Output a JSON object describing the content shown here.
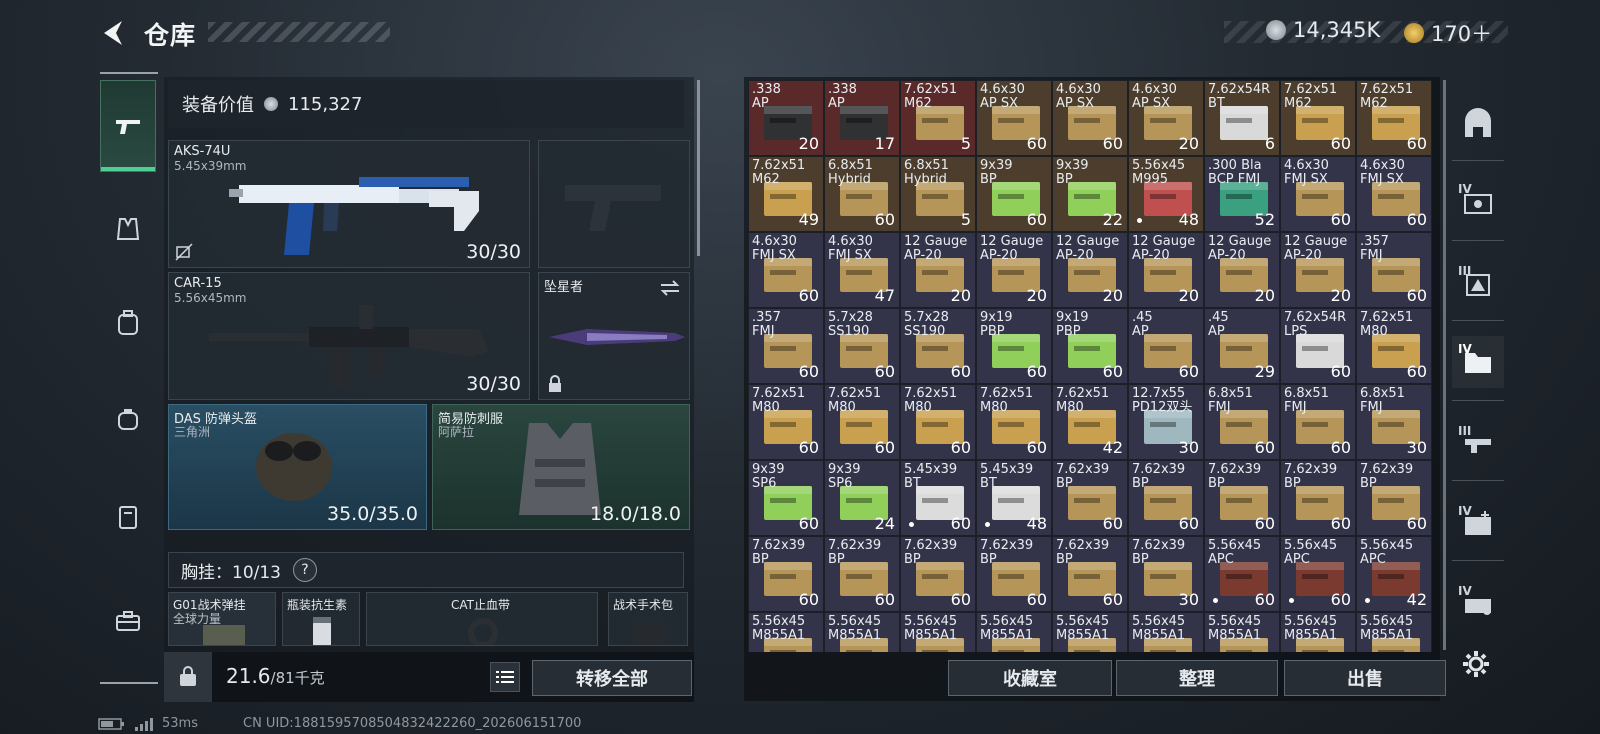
{
  "header": {
    "title": "仓库"
  },
  "currency": {
    "primary": "14,345K",
    "secondary": "170＋"
  },
  "equip_value": {
    "label": "装备价值",
    "value": "115,327"
  },
  "weapons": [
    {
      "name": "AKS-74U",
      "caliber": "5.45x39mm",
      "ammo": "30/30"
    },
    {
      "name": "CAR-15",
      "caliber": "5.56x45mm",
      "ammo": "30/30"
    }
  ],
  "melee": {
    "name": "坠星者"
  },
  "helmet": {
    "name": "DAS 防弹头盔",
    "origin": "三角洲",
    "durability": "35.0/35.0"
  },
  "armor": {
    "name": "简易防刺服",
    "origin": "阿萨拉",
    "durability": "18.0/18.0"
  },
  "rig": {
    "label": "胸挂：",
    "capacity": "10/13",
    "help": "?"
  },
  "rig_slots": [
    {
      "name": "G01战术弹挂",
      "sub": "全球力量"
    },
    {
      "name": "瓶装抗生素",
      "sub": ""
    },
    {
      "name": "CAT止血带",
      "sub": ""
    },
    {
      "name": "战术手术包",
      "sub": ""
    }
  ],
  "weight": {
    "current": "21.6",
    "max": "/81千克"
  },
  "buttons": {
    "transfer_all": "转移全部",
    "collection": "收藏室",
    "organize": "整理",
    "sell": "出售"
  },
  "status": {
    "ping": "53ms",
    "uid": "CN UID:1881595708504832422260_202606151700"
  },
  "right_nav": [
    "",
    "IV",
    "III",
    "IV",
    "III",
    "IV",
    "IV"
  ],
  "ammo": [
    {
      "label": ".338\nAP",
      "qty": "20",
      "bg": "#5a2a2a",
      "box": "#2f3133",
      "dot": false
    },
    {
      "label": ".338\nAP",
      "qty": "17",
      "bg": "#5a2a2a",
      "box": "#2f3133",
      "dot": false
    },
    {
      "label": "7.62x51\nM62",
      "qty": "5",
      "bg": "#5a2a2a",
      "box": "#b59658",
      "dot": false
    },
    {
      "label": "4.6x30\nAP SX",
      "qty": "60",
      "bg": "#4c3d2c",
      "box": "#b59658",
      "dot": false
    },
    {
      "label": "4.6x30\nAP SX",
      "qty": "60",
      "bg": "#4c3d2c",
      "box": "#b59658",
      "dot": false
    },
    {
      "label": "4.6x30\nAP SX",
      "qty": "20",
      "bg": "#4c3d2c",
      "box": "#b59658",
      "dot": false
    },
    {
      "label": "7.62x54R\nBT",
      "qty": "6",
      "bg": "#4c3d2c",
      "box": "#d9d9d9",
      "dot": false
    },
    {
      "label": "7.62x51\nM62",
      "qty": "60",
      "bg": "#4c3d2c",
      "box": "#c9a050",
      "dot": false
    },
    {
      "label": "7.62x51\nM62",
      "qty": "60",
      "bg": "#4c3d2c",
      "box": "#c9a050",
      "dot": false
    },
    {
      "label": "7.62x51\nM62",
      "qty": "49",
      "bg": "#4c3d2c",
      "box": "#c9a050",
      "dot": false
    },
    {
      "label": "6.8x51\nHybrid",
      "qty": "60",
      "bg": "#4c3d2c",
      "box": "#b59658",
      "dot": false
    },
    {
      "label": "6.8x51\nHybrid",
      "qty": "5",
      "bg": "#4c3d2c",
      "box": "#b59658",
      "dot": false
    },
    {
      "label": "9x39\nBP",
      "qty": "60",
      "bg": "#4c3d2c",
      "box": "#8fcf5a",
      "dot": false
    },
    {
      "label": "9x39\nBP",
      "qty": "22",
      "bg": "#4c3d2c",
      "box": "#8fcf5a",
      "dot": false
    },
    {
      "label": "5.56x45\nM995",
      "qty": "48",
      "bg": "#4c3d2c",
      "box": "#c05050",
      "dot": true
    },
    {
      "label": ".300 Bla\nBCP FMJ",
      "qty": "52",
      "bg": "#33344a",
      "box": "#3aa080",
      "dot": false
    },
    {
      "label": "4.6x30\nFMJ SX",
      "qty": "60",
      "bg": "#33344a",
      "box": "#b59658",
      "dot": false
    },
    {
      "label": "4.6x30\nFMJ SX",
      "qty": "60",
      "bg": "#33344a",
      "box": "#b59658",
      "dot": false
    },
    {
      "label": "4.6x30\nFMJ SX",
      "qty": "60",
      "bg": "#33344a",
      "box": "#b59658",
      "dot": false
    },
    {
      "label": "4.6x30\nFMJ SX",
      "qty": "47",
      "bg": "#33344a",
      "box": "#b59658",
      "dot": false
    },
    {
      "label": "12 Gauge\nAP-20",
      "qty": "20",
      "bg": "#33344a",
      "box": "#b59658",
      "dot": false
    },
    {
      "label": "12 Gauge\nAP-20",
      "qty": "20",
      "bg": "#33344a",
      "box": "#b59658",
      "dot": false
    },
    {
      "label": "12 Gauge\nAP-20",
      "qty": "20",
      "bg": "#33344a",
      "box": "#b59658",
      "dot": false
    },
    {
      "label": "12 Gauge\nAP-20",
      "qty": "20",
      "bg": "#33344a",
      "box": "#b59658",
      "dot": false
    },
    {
      "label": "12 Gauge\nAP-20",
      "qty": "20",
      "bg": "#33344a",
      "box": "#b59658",
      "dot": false
    },
    {
      "label": "12 Gauge\nAP-20",
      "qty": "20",
      "bg": "#33344a",
      "box": "#b59658",
      "dot": false
    },
    {
      "label": ".357\nFMJ",
      "qty": "60",
      "bg": "#33344a",
      "box": "#b59658",
      "dot": false
    },
    {
      "label": ".357\nFMJ",
      "qty": "60",
      "bg": "#33344a",
      "box": "#b59658",
      "dot": false
    },
    {
      "label": "5.7x28\nSS190",
      "qty": "60",
      "bg": "#33344a",
      "box": "#b59658",
      "dot": false
    },
    {
      "label": "5.7x28\nSS190",
      "qty": "60",
      "bg": "#33344a",
      "box": "#b59658",
      "dot": false
    },
    {
      "label": "9x19\nPBP",
      "qty": "60",
      "bg": "#33344a",
      "box": "#8fcf5a",
      "dot": false
    },
    {
      "label": "9x19\nPBP",
      "qty": "60",
      "bg": "#33344a",
      "box": "#8fcf5a",
      "dot": false
    },
    {
      "label": ".45\nAP",
      "qty": "60",
      "bg": "#33344a",
      "box": "#b59658",
      "dot": false
    },
    {
      "label": ".45\nAP",
      "qty": "29",
      "bg": "#33344a",
      "box": "#b59658",
      "dot": false
    },
    {
      "label": "7.62x54R\nLPS",
      "qty": "60",
      "bg": "#33344a",
      "box": "#d9d9d9",
      "dot": false
    },
    {
      "label": "7.62x51\nM80",
      "qty": "60",
      "bg": "#33344a",
      "box": "#c9a050",
      "dot": false
    },
    {
      "label": "7.62x51\nM80",
      "qty": "60",
      "bg": "#33344a",
      "box": "#c9a050",
      "dot": false
    },
    {
      "label": "7.62x51\nM80",
      "qty": "60",
      "bg": "#33344a",
      "box": "#c9a050",
      "dot": false
    },
    {
      "label": "7.62x51\nM80",
      "qty": "60",
      "bg": "#33344a",
      "box": "#c9a050",
      "dot": false
    },
    {
      "label": "7.62x51\nM80",
      "qty": "60",
      "bg": "#33344a",
      "box": "#c9a050",
      "dot": false
    },
    {
      "label": "7.62x51\nM80",
      "qty": "42",
      "bg": "#33344a",
      "box": "#c9a050",
      "dot": false
    },
    {
      "label": "12.7x55\nPD12双头",
      "qty": "30",
      "bg": "#33344a",
      "box": "#9fb8c0",
      "dot": false
    },
    {
      "label": "6.8x51\nFMJ",
      "qty": "60",
      "bg": "#33344a",
      "box": "#b59658",
      "dot": false
    },
    {
      "label": "6.8x51\nFMJ",
      "qty": "60",
      "bg": "#33344a",
      "box": "#b59658",
      "dot": false
    },
    {
      "label": "6.8x51\nFMJ",
      "qty": "30",
      "bg": "#33344a",
      "box": "#b59658",
      "dot": false
    },
    {
      "label": "9x39\nSP6",
      "qty": "60",
      "bg": "#33344a",
      "box": "#8fcf5a",
      "dot": false
    },
    {
      "label": "9x39\nSP6",
      "qty": "24",
      "bg": "#33344a",
      "box": "#8fcf5a",
      "dot": false
    },
    {
      "label": "5.45x39\nBT",
      "qty": "60",
      "bg": "#33344a",
      "box": "#dcdcdc",
      "dot": true
    },
    {
      "label": "5.45x39\nBT",
      "qty": "48",
      "bg": "#33344a",
      "box": "#dcdcdc",
      "dot": true
    },
    {
      "label": "7.62x39\nBP",
      "qty": "60",
      "bg": "#33344a",
      "box": "#b59658",
      "dot": false
    },
    {
      "label": "7.62x39\nBP",
      "qty": "60",
      "bg": "#33344a",
      "box": "#b59658",
      "dot": false
    },
    {
      "label": "7.62x39\nBP",
      "qty": "60",
      "bg": "#33344a",
      "box": "#b59658",
      "dot": false
    },
    {
      "label": "7.62x39\nBP",
      "qty": "60",
      "bg": "#33344a",
      "box": "#b59658",
      "dot": false
    },
    {
      "label": "7.62x39\nBP",
      "qty": "60",
      "bg": "#33344a",
      "box": "#b59658",
      "dot": false
    },
    {
      "label": "7.62x39\nBP",
      "qty": "60",
      "bg": "#33344a",
      "box": "#b59658",
      "dot": false
    },
    {
      "label": "7.62x39\nBP",
      "qty": "60",
      "bg": "#33344a",
      "box": "#b59658",
      "dot": false
    },
    {
      "label": "7.62x39\nBP",
      "qty": "60",
      "bg": "#33344a",
      "box": "#b59658",
      "dot": false
    },
    {
      "label": "7.62x39\nBP",
      "qty": "60",
      "bg": "#33344a",
      "box": "#b59658",
      "dot": false
    },
    {
      "label": "7.62x39\nBP",
      "qty": "60",
      "bg": "#33344a",
      "box": "#b59658",
      "dot": false
    },
    {
      "label": "7.62x39\nBP",
      "qty": "30",
      "bg": "#33344a",
      "box": "#b59658",
      "dot": false
    },
    {
      "label": "5.56x45\nAPC",
      "qty": "60",
      "bg": "#33344a",
      "box": "#7a3a30",
      "dot": true
    },
    {
      "label": "5.56x45\nAPC",
      "qty": "60",
      "bg": "#33344a",
      "box": "#7a3a30",
      "dot": true
    },
    {
      "label": "5.56x45\nAPC",
      "qty": "42",
      "bg": "#33344a",
      "box": "#7a3a30",
      "dot": true
    },
    {
      "label": "5.56x45\nM855A1",
      "qty": "",
      "bg": "#33344a",
      "box": "#b59658",
      "dot": false
    },
    {
      "label": "5.56x45\nM855A1",
      "qty": "",
      "bg": "#33344a",
      "box": "#b59658",
      "dot": false
    },
    {
      "label": "5.56x45\nM855A1",
      "qty": "",
      "bg": "#33344a",
      "box": "#b59658",
      "dot": false
    },
    {
      "label": "5.56x45\nM855A1",
      "qty": "",
      "bg": "#33344a",
      "box": "#b59658",
      "dot": false
    },
    {
      "label": "5.56x45\nM855A1",
      "qty": "",
      "bg": "#33344a",
      "box": "#b59658",
      "dot": false
    },
    {
      "label": "5.56x45\nM855A1",
      "qty": "",
      "bg": "#33344a",
      "box": "#b59658",
      "dot": false
    },
    {
      "label": "5.56x45\nM855A1",
      "qty": "",
      "bg": "#33344a",
      "box": "#b59658",
      "dot": false
    },
    {
      "label": "5.56x45\nM855A1",
      "qty": "",
      "bg": "#33344a",
      "box": "#b59658",
      "dot": false
    },
    {
      "label": "5.56x45\nM855A1",
      "qty": "",
      "bg": "#33344a",
      "box": "#b59658",
      "dot": false
    }
  ]
}
